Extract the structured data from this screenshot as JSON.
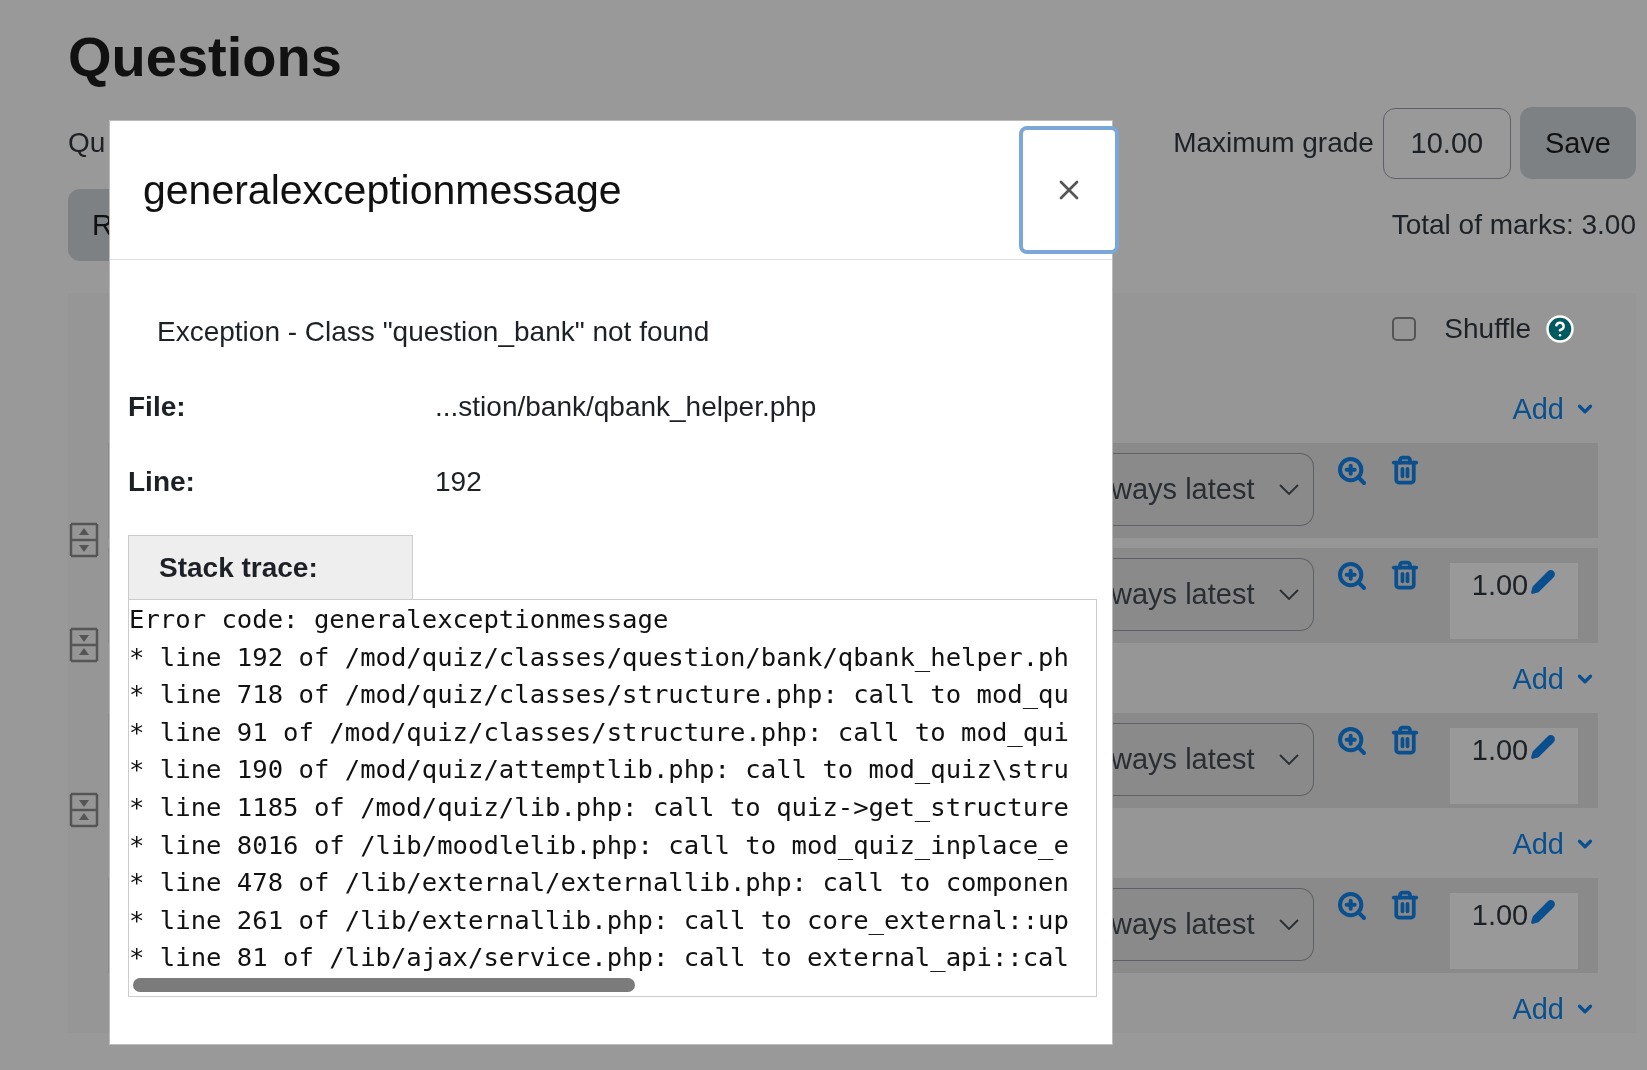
{
  "page": {
    "title": "Questions",
    "cut_heading": "Qu",
    "cut_button": "R"
  },
  "grade": {
    "label": "Maximum grade",
    "value": "10.00",
    "save": "Save",
    "total": "Total of marks: 3.00"
  },
  "section": {
    "shuffle": {
      "label": "Shuffle",
      "checked": false
    },
    "items": [
      {
        "kind": "add",
        "label": "Add"
      },
      {
        "kind": "slot",
        "version": "ways latest",
        "page_break": true
      },
      {
        "kind": "slot",
        "version": "ways latest",
        "mark": "1.00",
        "page_break": false
      },
      {
        "kind": "add",
        "label": "Add"
      },
      {
        "kind": "slot",
        "version": "ways latest",
        "mark": "1.00",
        "page_break": false
      },
      {
        "kind": "add",
        "label": "Add"
      },
      {
        "kind": "slot",
        "version": "ways latest",
        "mark": "1.00"
      },
      {
        "kind": "add",
        "label": "Add"
      }
    ]
  },
  "dialog": {
    "title": "generalexceptionmessage",
    "message": "Exception - Class \"question_bank\" not found",
    "fields": [
      {
        "label": "File:",
        "value": "...stion/bank/qbank_helper.php"
      },
      {
        "label": "Line:",
        "value": "192"
      }
    ],
    "trace_tab": "Stack trace:",
    "trace": [
      "Error code: generalexceptionmessage",
      "* line 192 of /mod/quiz/classes/question/bank/qbank_helper.ph",
      "* line 718 of /mod/quiz/classes/structure.php: call to mod_qu",
      "* line 91 of /mod/quiz/classes/structure.php: call to mod_qui",
      "* line 190 of /mod/quiz/attemptlib.php: call to mod_quiz\\stru",
      "* line 1185 of /mod/quiz/lib.php: call to quiz->get_structure",
      "* line 8016 of /lib/moodlelib.php: call to mod_quiz_inplace_e",
      "* line 478 of /lib/external/externallib.php: call to componen",
      "* line 261 of /lib/externallib.php: call to core_external::up",
      "* line 81 of /lib/ajax/service.php: call to external_api::cal"
    ]
  }
}
